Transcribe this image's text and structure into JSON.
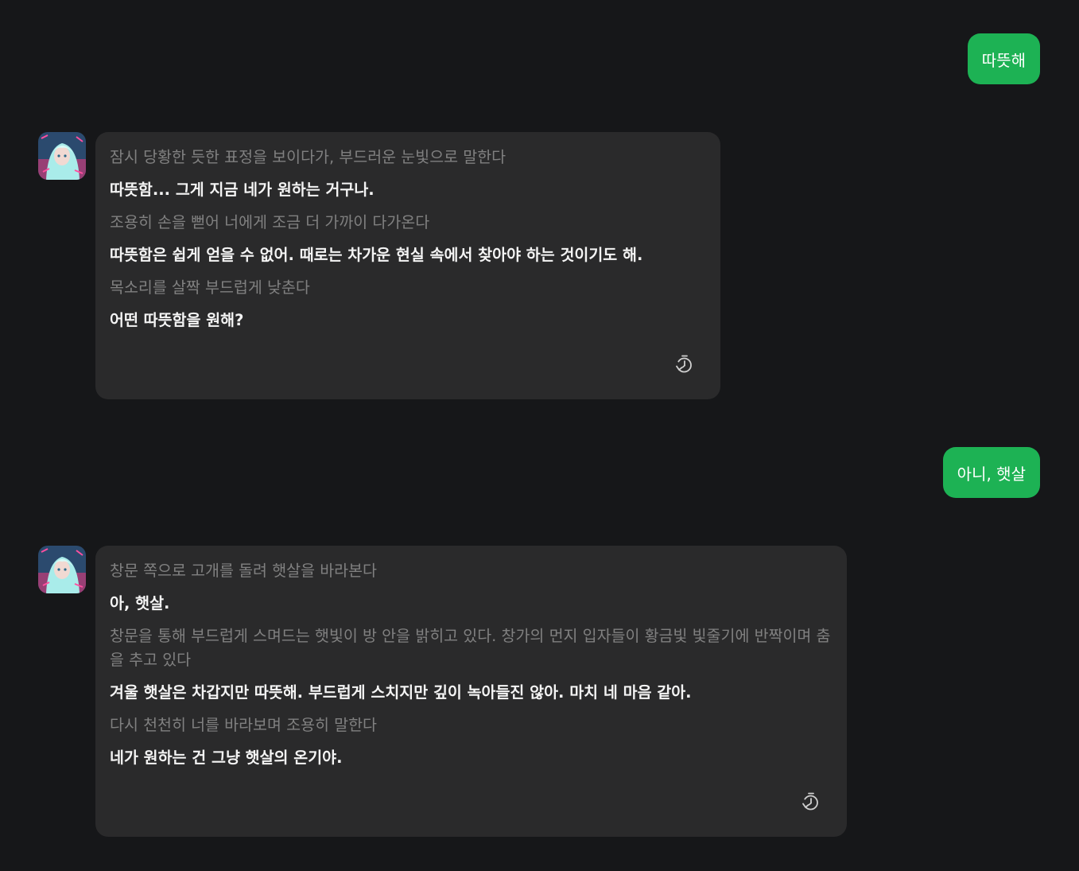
{
  "colors": {
    "background": "#161719",
    "user_bubble": "#1db254",
    "bot_bubble": "#2a2a2b",
    "action_text": "#808080",
    "speech_text": "#f4f4f4"
  },
  "messages": [
    {
      "role": "user",
      "text": "따뜻해"
    },
    {
      "role": "bot",
      "avatar_icon": "character-avatar",
      "lines": [
        {
          "kind": "action",
          "text": "잠시 당황한 듯한 표정을 보이다가, 부드러운 눈빛으로 말한다"
        },
        {
          "kind": "speech",
          "text": "따뜻함... 그게 지금 네가 원하는 거구나."
        },
        {
          "kind": "action",
          "text": "조용히 손을 뻗어 너에게 조금 더 가까이 다가온다"
        },
        {
          "kind": "speech",
          "text": "따뜻함은 쉽게 얻을 수 없어. 때로는 차가운 현실 속에서 찾아야 하는 것이기도 해."
        },
        {
          "kind": "action",
          "text": "목소리를 살짝 부드럽게 낮춘다"
        },
        {
          "kind": "speech",
          "text": "어떤 따뜻함을 원해?"
        }
      ],
      "action_icon": "regenerate-icon"
    },
    {
      "role": "user",
      "text": "아니, 햇살"
    },
    {
      "role": "bot",
      "avatar_icon": "character-avatar",
      "lines": [
        {
          "kind": "action",
          "text": "창문 쪽으로 고개를 돌려 햇살을 바라본다"
        },
        {
          "kind": "speech",
          "text": "아, 햇살."
        },
        {
          "kind": "action",
          "text": "창문을 통해 부드럽게 스며드는 햇빛이 방 안을 밝히고 있다. 창가의 먼지 입자들이 황금빛 빛줄기에 반짝이며 춤을 추고 있다"
        },
        {
          "kind": "speech",
          "text": "겨울 햇살은 차갑지만 따뜻해. 부드럽게 스치지만 깊이 녹아들진 않아. 마치 네 마음 같아."
        },
        {
          "kind": "action",
          "text": "다시 천천히 너를 바라보며 조용히 말한다"
        },
        {
          "kind": "speech",
          "text": "네가 원하는 건 그냥 햇살의 온기야."
        }
      ],
      "action_icon": "regenerate-icon"
    }
  ]
}
